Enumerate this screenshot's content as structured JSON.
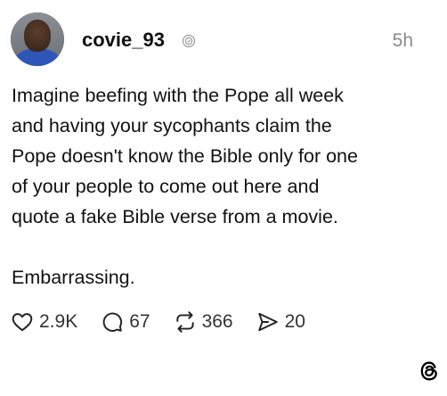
{
  "post": {
    "author": {
      "username": "covie_93",
      "avatar_icon": "profile-photo",
      "verified_icon": "threads-badge-icon"
    },
    "timestamp": "5h",
    "body": {
      "paragraph1_lines": [
        "Imagine beefing with the Pope all week",
        "and having your sycophants claim the",
        "Pope doesn't know the Bible only for one",
        "of your people to come out here and",
        "quote a fake Bible verse from a movie."
      ],
      "paragraph2": "Embarrassing."
    },
    "actions": {
      "like": {
        "icon": "heart-icon",
        "count": "2.9K"
      },
      "reply": {
        "icon": "comment-icon",
        "count": "67"
      },
      "repost": {
        "icon": "repost-icon",
        "count": "366"
      },
      "share": {
        "icon": "send-icon",
        "count": "20"
      }
    },
    "logo": {
      "icon": "threads-logo-icon"
    }
  },
  "colors": {
    "text": "#111111",
    "muted": "#8a8a8a",
    "background": "#ffffff"
  }
}
